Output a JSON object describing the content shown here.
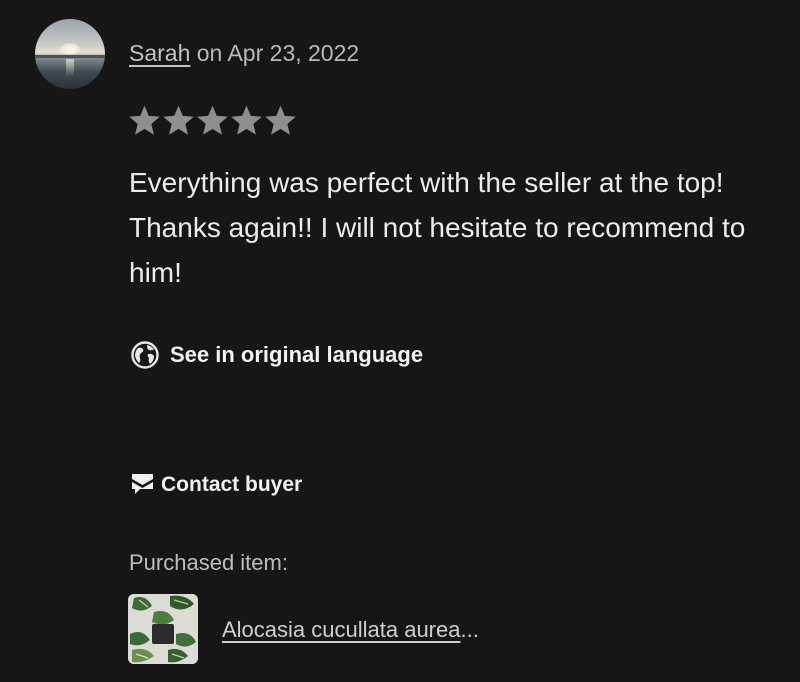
{
  "review": {
    "reviewer_name": "Sarah",
    "date_text": "on Apr 23, 2022",
    "rating": 5,
    "max_rating": 5,
    "star_color": "#8f8f8f",
    "text": "Everything was perfect with the seller at the top! Thanks again!! I will not hesitate to recommend to him!"
  },
  "actions": {
    "translate_label": "See in original language",
    "translate_icon": "globe-icon",
    "contact_label": "Contact buyer",
    "contact_icon": "envelope-icon"
  },
  "purchase": {
    "heading": "Purchased item:",
    "item_title": "Alocasia cucullata aurea",
    "ellipsis": "..."
  },
  "colors": {
    "background": "#161616",
    "primary_text": "#ececec",
    "secondary_text": "#b9b9b9"
  }
}
